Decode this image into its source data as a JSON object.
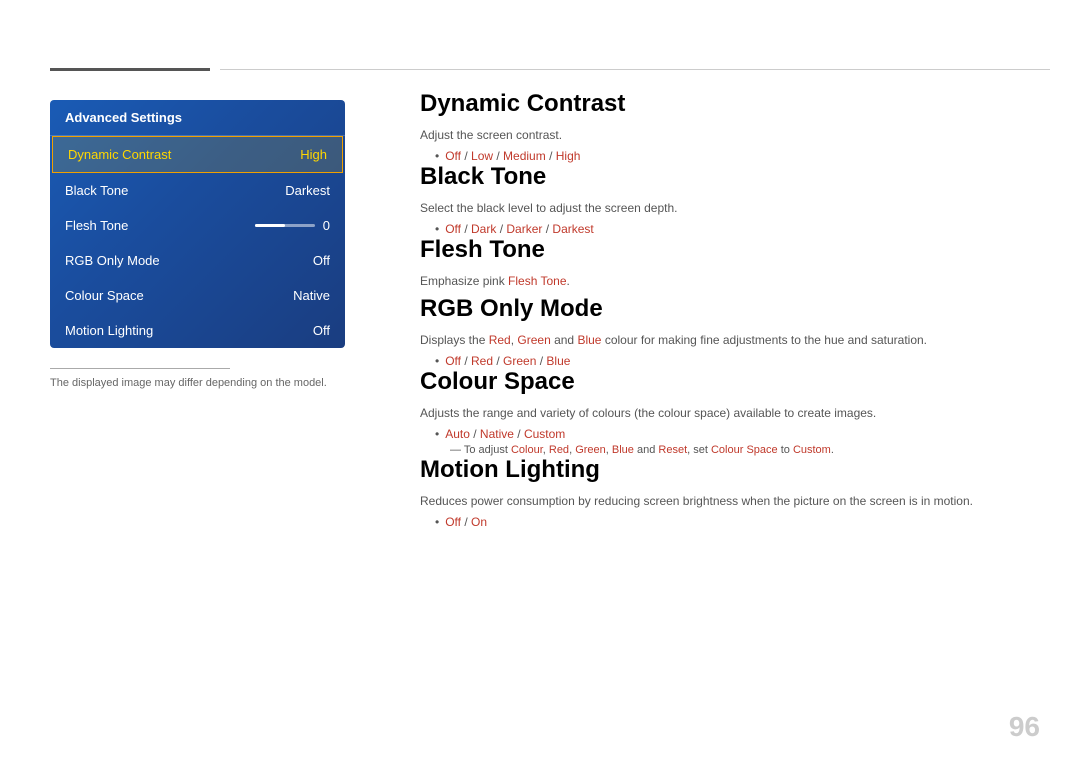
{
  "topLines": {},
  "leftPanel": {
    "menuTitle": "Advanced Settings",
    "menuItems": [
      {
        "label": "Dynamic Contrast",
        "value": "High",
        "active": true
      },
      {
        "label": "Black Tone",
        "value": "Darkest",
        "active": false
      },
      {
        "label": "Flesh Tone",
        "value": "0",
        "active": false,
        "hasSlider": true
      },
      {
        "label": "RGB Only Mode",
        "value": "Off",
        "active": false
      },
      {
        "label": "Colour Space",
        "value": "Native",
        "active": false
      },
      {
        "label": "Motion Lighting",
        "value": "Off",
        "active": false
      }
    ],
    "disclaimer": "The displayed image may differ depending on the model."
  },
  "rightContent": {
    "sections": [
      {
        "id": "dynamic-contrast",
        "title": "Dynamic Contrast",
        "desc": "Adjust the screen contrast.",
        "options": [
          {
            "text": "Off",
            "highlight": true
          },
          {
            "text": " / ",
            "highlight": false
          },
          {
            "text": "Low",
            "highlight": true
          },
          {
            "text": " / ",
            "highlight": false
          },
          {
            "text": "Medium",
            "highlight": true
          },
          {
            "text": " / ",
            "highlight": false
          },
          {
            "text": "High",
            "highlight": true
          }
        ],
        "subNote": null
      },
      {
        "id": "black-tone",
        "title": "Black Tone",
        "desc": "Select the black level to adjust the screen depth.",
        "options": [
          {
            "text": "Off",
            "highlight": true
          },
          {
            "text": " / ",
            "highlight": false
          },
          {
            "text": "Dark",
            "highlight": true
          },
          {
            "text": " / ",
            "highlight": false
          },
          {
            "text": "Darker",
            "highlight": true
          },
          {
            "text": " / ",
            "highlight": false
          },
          {
            "text": "Darkest",
            "highlight": true
          }
        ],
        "subNote": null
      },
      {
        "id": "flesh-tone",
        "title": "Flesh Tone",
        "desc": "Emphasize pink Flesh Tone.",
        "options": null,
        "subNote": null
      },
      {
        "id": "rgb-only-mode",
        "title": "RGB Only Mode",
        "desc": "Displays the Red, Green and Blue colour for making fine adjustments to the hue and saturation.",
        "options": [
          {
            "text": "Off",
            "highlight": true
          },
          {
            "text": " / ",
            "highlight": false
          },
          {
            "text": "Red",
            "highlight": true
          },
          {
            "text": " / ",
            "highlight": false
          },
          {
            "text": "Green",
            "highlight": true
          },
          {
            "text": " / ",
            "highlight": false
          },
          {
            "text": "Blue",
            "highlight": true
          }
        ],
        "subNote": null
      },
      {
        "id": "colour-space",
        "title": "Colour Space",
        "desc": "Adjusts the range and variety of colours (the colour space) available to create images.",
        "options": [
          {
            "text": "Auto",
            "highlight": true
          },
          {
            "text": " / ",
            "highlight": false
          },
          {
            "text": "Native",
            "highlight": true
          },
          {
            "text": " / ",
            "highlight": false
          },
          {
            "text": "Custom",
            "highlight": true
          }
        ],
        "subNote": "To adjust Colour, Red, Green, Blue and Reset, set Colour Space to Custom."
      },
      {
        "id": "motion-lighting",
        "title": "Motion Lighting",
        "desc": "Reduces power consumption by reducing screen brightness when the picture on the screen is in motion.",
        "options": [
          {
            "text": "Off",
            "highlight": true
          },
          {
            "text": " / ",
            "highlight": false
          },
          {
            "text": "On",
            "highlight": true
          }
        ],
        "subNote": null
      }
    ]
  },
  "pageNumber": "96"
}
